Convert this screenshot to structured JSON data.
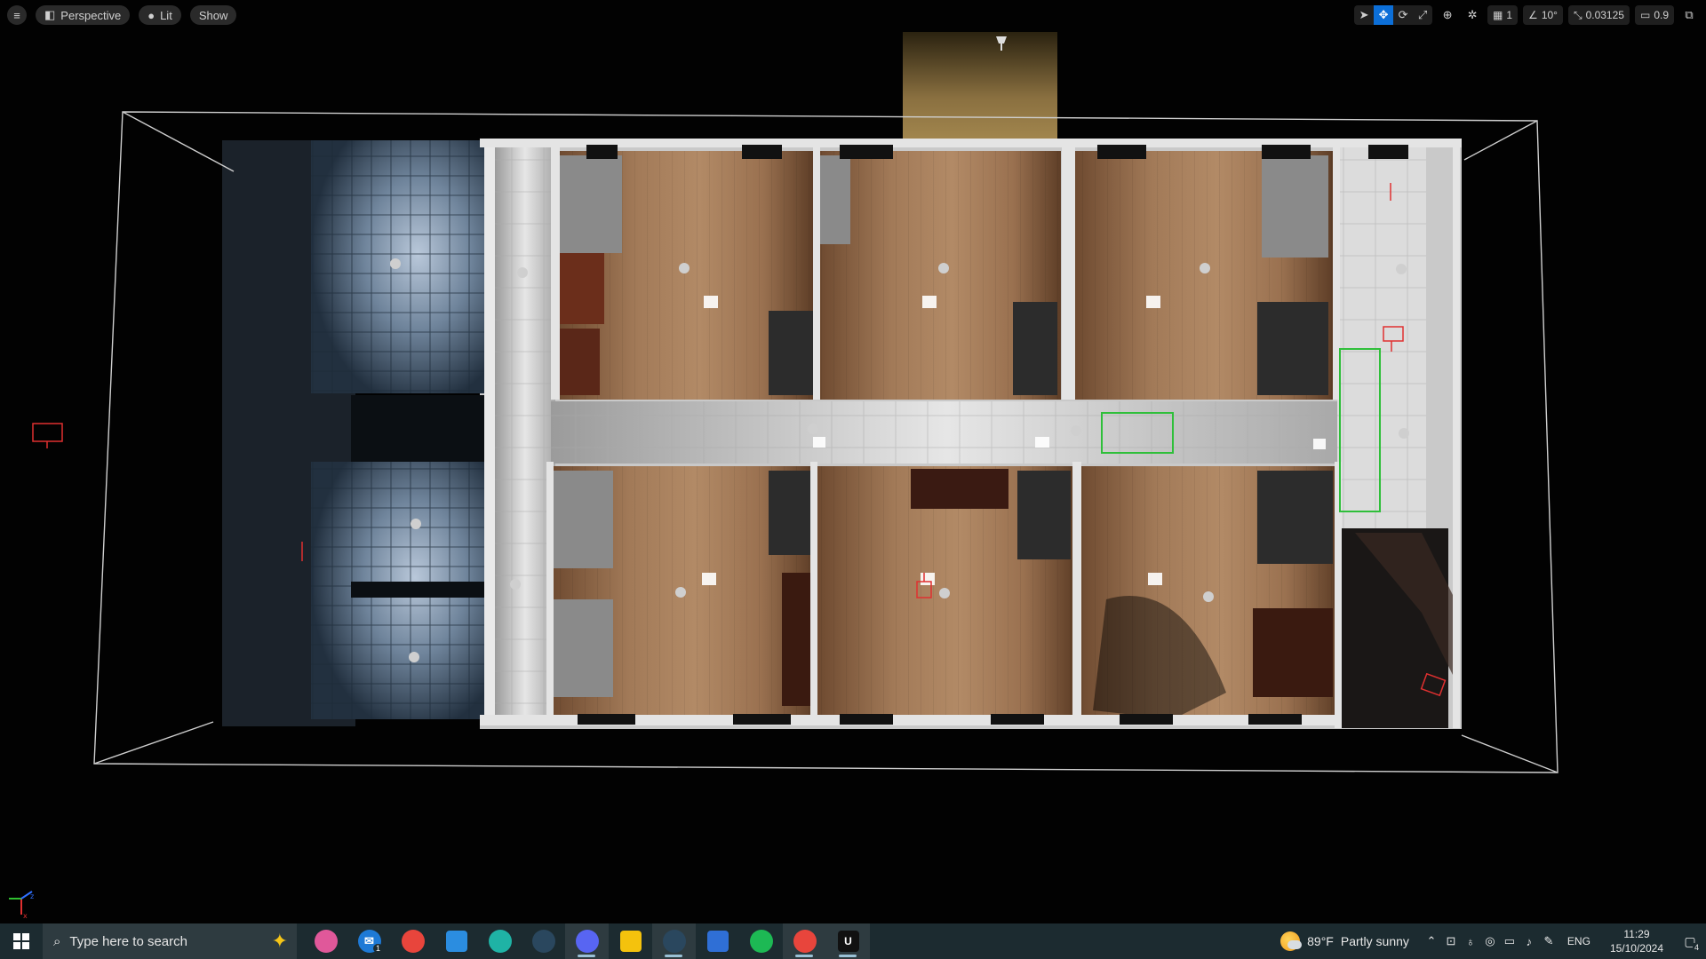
{
  "viewport": {
    "menu_icon": "hamburger-icon",
    "view_mode": "Perspective",
    "lighting_mode": "Lit",
    "show_label": "Show",
    "toolbar": {
      "select_icon": "cursor-icon",
      "translate_icon": "move-icon",
      "rotate_icon": "rotate-icon",
      "scale_icon": "scale-icon",
      "world_icon": "globe-icon",
      "surface_snap_icon": "surface-snap-icon",
      "grid_snap_value": "1",
      "rotation_snap_value": "10°",
      "scale_snap_value": "0.03125",
      "camera_speed_value": "0.9",
      "maximize_icon": "maximize-icon",
      "active_tool": "translate"
    },
    "axis": {
      "x_label": "x",
      "z_label": "z"
    }
  },
  "taskbar": {
    "search_placeholder": "Type here to search",
    "apps": [
      {
        "name": "copilot",
        "icon": "copilot-icon",
        "glyph": "",
        "color": "#e0589a",
        "running": false
      },
      {
        "name": "mail",
        "icon": "mail-icon",
        "glyph": "✉",
        "color": "#1e7ad6",
        "running": false,
        "badge": "1"
      },
      {
        "name": "chrome",
        "icon": "chrome-icon",
        "glyph": "",
        "color": "#e8453c",
        "running": false
      },
      {
        "name": "store",
        "icon": "store-icon",
        "glyph": "",
        "color": "#2b8de0",
        "running": false
      },
      {
        "name": "edge",
        "icon": "edge-icon",
        "glyph": "",
        "color": "#1fb3a5",
        "running": false
      },
      {
        "name": "steam",
        "icon": "steam-icon",
        "glyph": "",
        "color": "#2a475e",
        "running": false
      },
      {
        "name": "discord",
        "icon": "discord-icon",
        "glyph": "",
        "color": "#5865f2",
        "running": true
      },
      {
        "name": "file-explorer",
        "icon": "folder-icon",
        "glyph": "",
        "color": "#f4c20d",
        "running": false
      },
      {
        "name": "steam-running",
        "icon": "steam-icon",
        "glyph": "",
        "color": "#2a475e",
        "running": true
      },
      {
        "name": "screen-capture",
        "icon": "capture-icon",
        "glyph": "",
        "color": "#2f6fd6",
        "running": false
      },
      {
        "name": "spotify",
        "icon": "spotify-icon",
        "glyph": "",
        "color": "#1db954",
        "running": false
      },
      {
        "name": "chrome-profile",
        "icon": "chrome-icon",
        "glyph": "",
        "color": "#e8453c",
        "running": true
      },
      {
        "name": "unreal-engine",
        "icon": "unreal-icon",
        "glyph": "U",
        "color": "#111111",
        "running": true
      }
    ],
    "weather": {
      "temp": "89°F",
      "desc": "Partly sunny"
    },
    "language": "ENG",
    "time": "11:29",
    "date": "15/10/2024",
    "notification_count": "4"
  }
}
